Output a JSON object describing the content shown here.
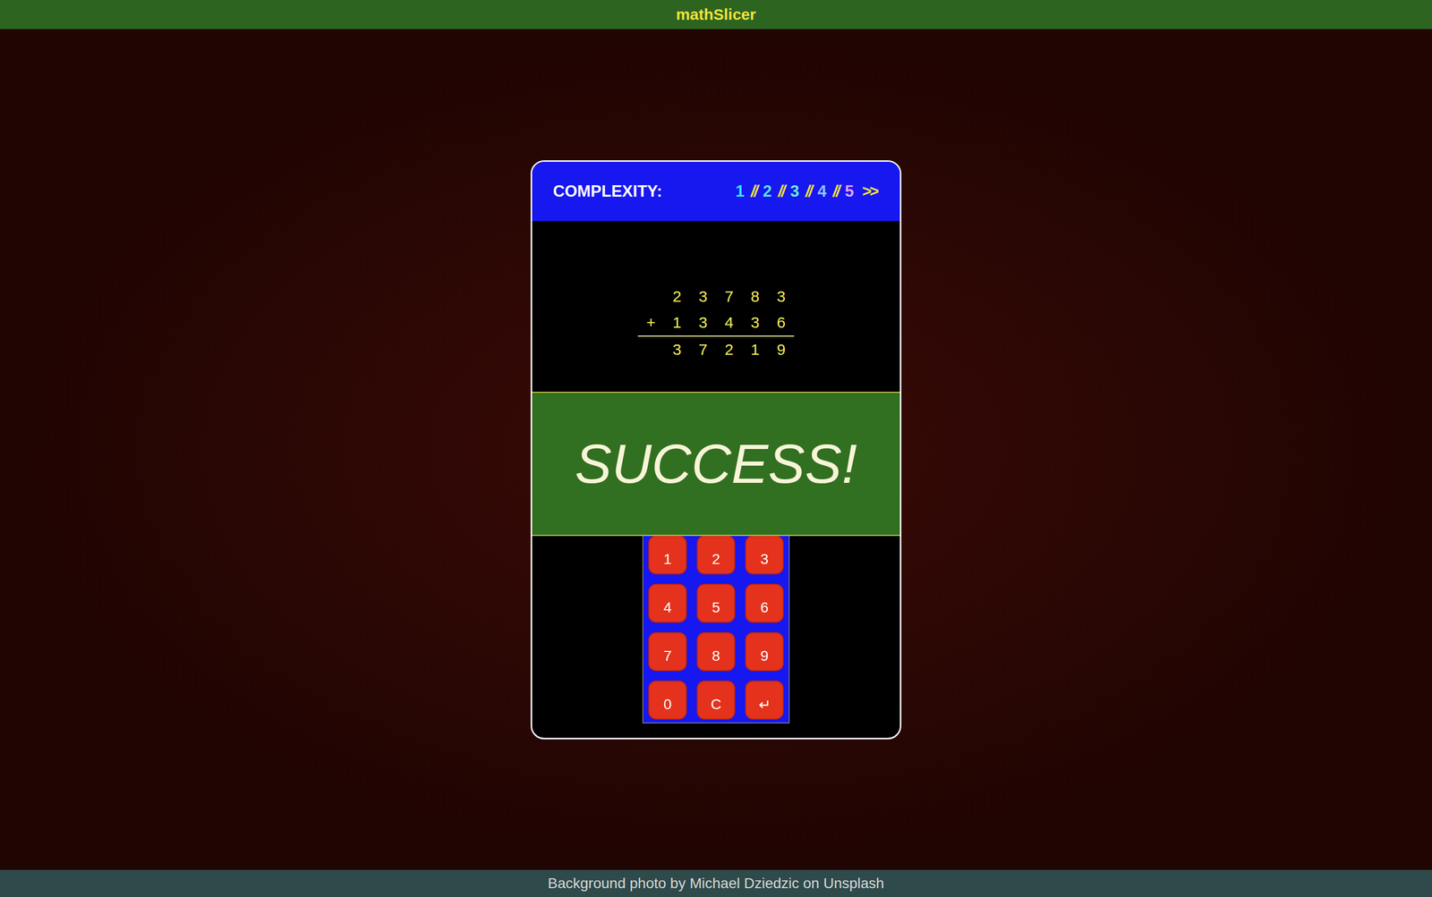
{
  "app": {
    "title": "mathSlicer"
  },
  "complexity": {
    "label": "COMPLEXITY:",
    "levels": [
      {
        "label": "1",
        "color": "#33e6ff"
      },
      {
        "label": "2",
        "color": "#5ce0ea"
      },
      {
        "label": "3",
        "color": "#66f5c8"
      },
      {
        "label": "4",
        "color": "#8cc8ff"
      },
      {
        "label": "5",
        "color": "#e3a3f0"
      }
    ],
    "separator": "//",
    "next": ">>"
  },
  "problem": {
    "operator": "+",
    "operands": [
      [
        "2",
        "3",
        "7",
        "8",
        "3"
      ],
      [
        "1",
        "3",
        "4",
        "3",
        "6"
      ]
    ],
    "answer": [
      "3",
      "7",
      "2",
      "1",
      "9"
    ]
  },
  "result": {
    "message": "SUCCESS!"
  },
  "keypad": {
    "keys": [
      "1",
      "2",
      "3",
      "4",
      "5",
      "6",
      "7",
      "8",
      "9",
      "0",
      "C",
      "↵"
    ]
  },
  "footer": {
    "credit": "Background photo by Michael Dziedzic on Unsplash"
  }
}
